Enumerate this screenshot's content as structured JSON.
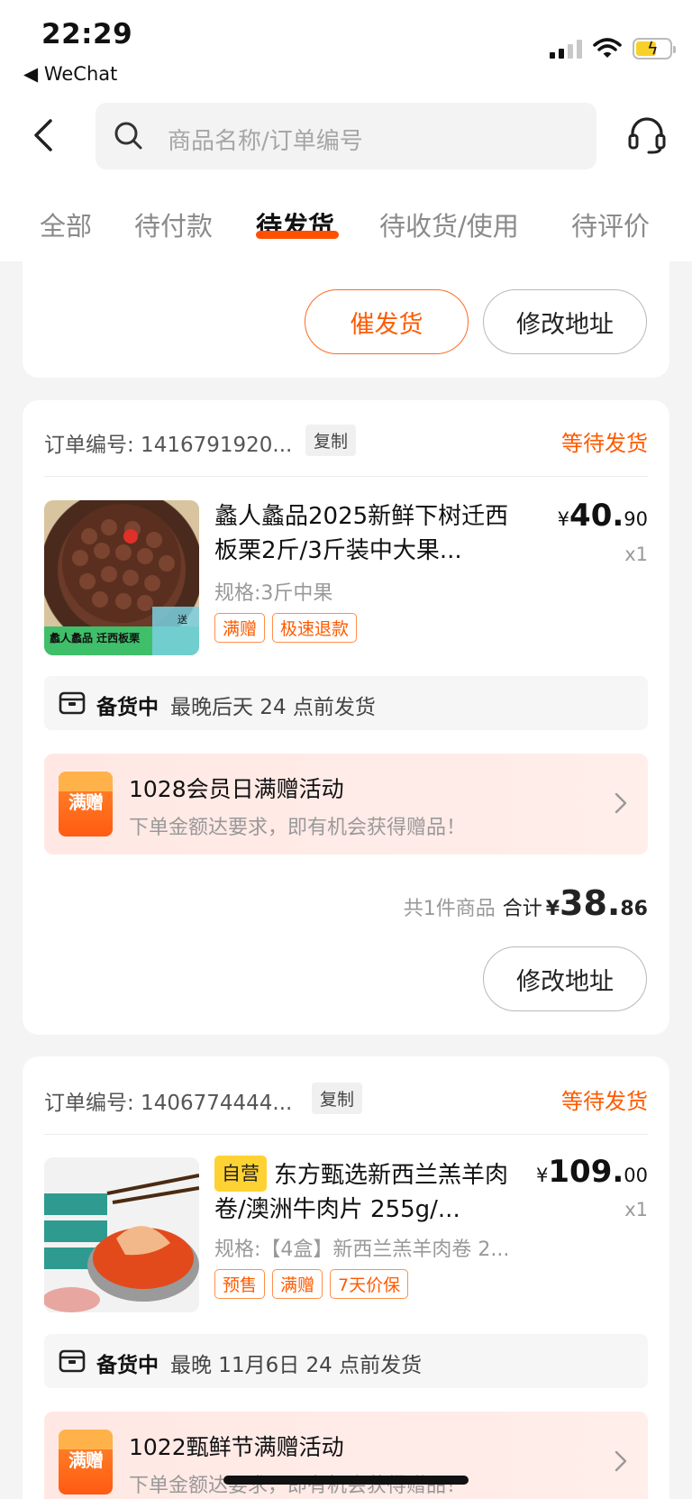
{
  "status_bar": {
    "time": "22:29",
    "back_app": "WeChat"
  },
  "header": {
    "search_placeholder": "商品名称/订单编号"
  },
  "tabs": [
    {
      "label": "全部"
    },
    {
      "label": "待付款"
    },
    {
      "label": "待发货",
      "active": true
    },
    {
      "label": "待收货/使用"
    },
    {
      "label": "待评价"
    }
  ],
  "card0": {
    "remind_button": "催发货",
    "address_button": "修改地址"
  },
  "orders": [
    {
      "order_no": "订单编号: 1416791920...",
      "copy_label": "复制",
      "status": "等待发货",
      "product": {
        "title": "蠡人蠡品2025新鲜下树迁西板栗2斤/3斤装中大果...",
        "price_currency": "¥",
        "price_int": "40.",
        "price_dec": "90",
        "qty": "x1",
        "spec": "规格:3斤中果",
        "tags": [
          "满赠",
          "极速退款"
        ],
        "image_caption": "蠡人蠡品 迁西板栗",
        "image_badge": "送"
      },
      "shipping": {
        "status": "备货中",
        "text": "最晚后天 24 点前发货"
      },
      "promo": {
        "badge": "满赠",
        "title": "1028会员日满赠活动",
        "subtitle": "下单金额达要求，即有机会获得赠品！"
      },
      "summary": {
        "count": "共1件商品",
        "label": "合计",
        "currency": "¥",
        "int": "38.",
        "dec": "86"
      },
      "button": "修改地址"
    },
    {
      "order_no": "订单编号: 1406774444...",
      "copy_label": "复制",
      "status": "等待发货",
      "product": {
        "self_tag": "自营",
        "title": "东方甄选新西兰羔羊肉卷/澳洲牛肉片 255g/...",
        "price_currency": "¥",
        "price_int": "109.",
        "price_dec": "00",
        "qty": "x1",
        "spec": "规格:【4盒】新西兰羔羊肉卷 2...",
        "tags": [
          "预售",
          "满赠",
          "7天价保"
        ]
      },
      "shipping": {
        "status": "备货中",
        "text": "最晚 11月6日 24 点前发货"
      },
      "promo": {
        "badge": "满赠",
        "title": "1022甄鲜节满赠活动",
        "subtitle": "下单金额达要求，即有机会获得赠品！"
      }
    }
  ],
  "colors": {
    "accent": "#ff5000",
    "promo_bg": "#ffe8e4",
    "self_tag": "#ffd233"
  }
}
